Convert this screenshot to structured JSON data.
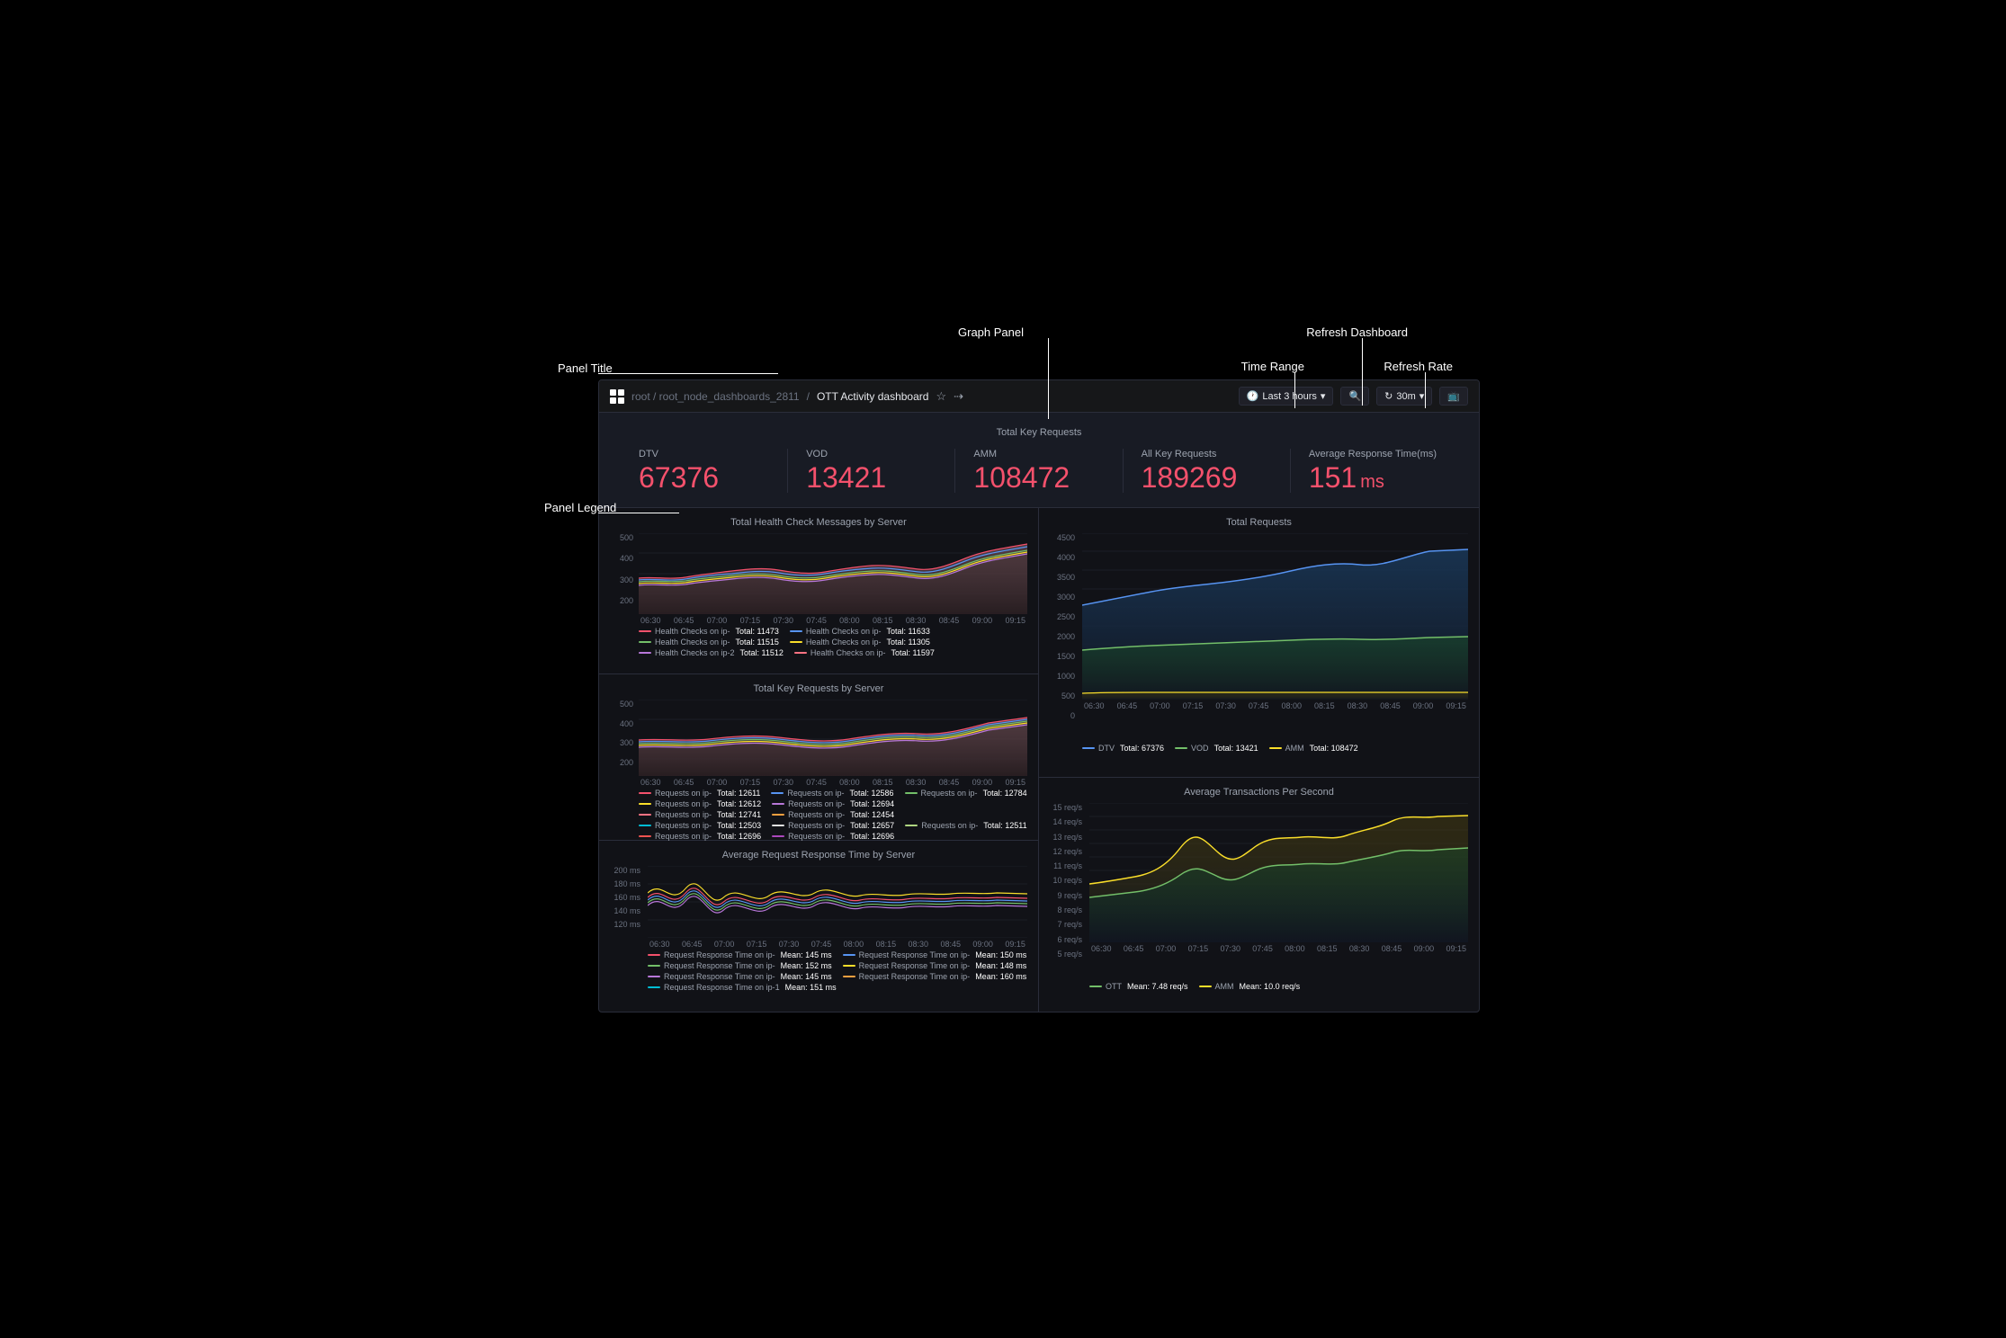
{
  "annotations": {
    "graph_panel": "Graph Panel",
    "panel_title": "Panel Title",
    "panel_legend": "Panel Legend",
    "refresh_dashboard": "Refresh Dashboard",
    "time_range": "Time Range",
    "refresh_rate": "Refresh Rate"
  },
  "topbar": {
    "breadcrumb": "root / root_node_dashboards_2811",
    "separator": "/",
    "title": "OTT Activity dashboard",
    "time_range": "Last 3 hours",
    "zoom_icon": "🔍",
    "refresh_icon": "↻",
    "refresh_rate": "30m",
    "tv_icon": "📺"
  },
  "stats": {
    "title": "Total Key Requests",
    "items": [
      {
        "label": "DTV",
        "value": "67376",
        "unit": ""
      },
      {
        "label": "VOD",
        "value": "13421",
        "unit": ""
      },
      {
        "label": "AMM",
        "value": "108472",
        "unit": ""
      },
      {
        "label": "All Key Requests",
        "value": "189269",
        "unit": ""
      },
      {
        "label": "Average Response Time(ms)",
        "value": "151",
        "unit": " ms"
      }
    ]
  },
  "panels": {
    "left": [
      {
        "title": "Total Health Check Messages by Server",
        "y_labels": [
          "500",
          "400",
          "300",
          "200"
        ],
        "x_labels": [
          "06:30",
          "06:45",
          "07:00",
          "07:15",
          "07:30",
          "07:45",
          "08:00",
          "08:15",
          "08:30",
          "08:45",
          "09:00",
          "09:15"
        ],
        "legend": [
          {
            "color": "#f4516c",
            "label": "Health Checks on ip-",
            "total": "Total: 11473"
          },
          {
            "color": "#5794f2",
            "label": "Health Checks on ip-",
            "total": "Total: 11633"
          },
          {
            "color": "#73bf69",
            "label": "Health Checks on ip-",
            "total": "Total: 11515"
          },
          {
            "color": "#fade2a",
            "label": "Health Checks on ip-",
            "total": "Total: 11305"
          },
          {
            "color": "#b877d9",
            "label": "Health Checks on ip-2",
            "total": "Total: 11512"
          },
          {
            "color": "#ff7383",
            "label": "Health Checks on ip-",
            "total": "Total: 11597"
          }
        ]
      },
      {
        "title": "Total Key Requests by Server",
        "y_labels": [
          "500",
          "400",
          "300",
          "200"
        ],
        "x_labels": [
          "06:30",
          "06:45",
          "07:00",
          "07:15",
          "07:30",
          "07:45",
          "08:00",
          "08:15",
          "08:30",
          "08:45",
          "09:00",
          "09:15"
        ],
        "legend": [
          {
            "color": "#f4516c",
            "label": "Requests on ip-",
            "total": "Total: 12611"
          },
          {
            "color": "#5794f2",
            "label": "Requests on ip-",
            "total": "Total: 12586"
          },
          {
            "color": "#73bf69",
            "label": "Requests on ip-",
            "total": "Total: 12784"
          },
          {
            "color": "#fade2a",
            "label": "Requests on ip-",
            "total": "Total: 12612"
          },
          {
            "color": "#b877d9",
            "label": "Requests on ip-",
            "total": "Total: 12694"
          },
          {
            "color": "#ff7383",
            "label": "Requests on ip-",
            "total": "Total: 12741"
          },
          {
            "color": "#f9a040",
            "label": "Requests on ip-",
            "total": "Total: 12454"
          },
          {
            "color": "#00bcd4",
            "label": "Requests on ip-",
            "total": "Total: 12503"
          },
          {
            "color": "#e0e0e0",
            "label": "Requests on ip-",
            "total": "Total: 12657"
          },
          {
            "color": "#aed581",
            "label": "Requests on ip-",
            "total": "Total: 12511"
          },
          {
            "color": "#ef5350",
            "label": "Requests on ip-",
            "total": "Total: 12696"
          },
          {
            "color": "#ab47bc",
            "label": "Requests on ip-",
            "total": "Total: 12696"
          }
        ]
      },
      {
        "title": "Average Request Response Time by Server",
        "y_labels": [
          "200 ms",
          "180 ms",
          "160 ms",
          "140 ms",
          "120 ms"
        ],
        "x_labels": [
          "06:30",
          "06:45",
          "07:00",
          "07:15",
          "07:30",
          "07:45",
          "08:00",
          "08:15",
          "08:30",
          "08:45",
          "09:00",
          "09:15"
        ],
        "legend": [
          {
            "color": "#f4516c",
            "label": "Request Response Time on ip-",
            "total": "Mean: 145 ms"
          },
          {
            "color": "#5794f2",
            "label": "Request Response Time on ip-",
            "total": "Mean: 150 ms"
          },
          {
            "color": "#73bf69",
            "label": "Request Response Time on ip-",
            "total": "Mean: 152 ms"
          },
          {
            "color": "#fade2a",
            "label": "Request Response Time on ip-",
            "total": "Mean: 148 ms"
          },
          {
            "color": "#b877d9",
            "label": "Request Response Time on ip-",
            "total": "Mean: 145 ms"
          },
          {
            "color": "#f9a040",
            "label": "Request Response Time on ip-",
            "total": "Mean: 160 ms"
          },
          {
            "color": "#00bcd4",
            "label": "Request Response Time on ip-1",
            "total": "Mean: 151 ms"
          }
        ]
      }
    ],
    "right": [
      {
        "title": "Total Requests",
        "y_labels": [
          "4500",
          "4000",
          "3500",
          "3000",
          "2500",
          "2000",
          "1500",
          "1000",
          "500",
          "0"
        ],
        "x_labels": [
          "06:30",
          "06:45",
          "07:00",
          "07:15",
          "07:30",
          "07:45",
          "08:00",
          "08:15",
          "08:30",
          "08:45",
          "09:00",
          "09:15"
        ],
        "legend": [
          {
            "color": "#5794f2",
            "label": "DTV",
            "total": "Total: 67376"
          },
          {
            "color": "#73bf69",
            "label": "VOD",
            "total": "Total: 13421"
          },
          {
            "color": "#fade2a",
            "label": "AMM",
            "total": "Total: 108472"
          }
        ]
      },
      {
        "title": "Average Transactions Per Second",
        "y_labels": [
          "15 req/s",
          "14 req/s",
          "13 req/s",
          "12 req/s",
          "11 req/s",
          "10 req/s",
          "9 req/s",
          "8 req/s",
          "7 req/s",
          "6 req/s",
          "5 req/s"
        ],
        "x_labels": [
          "06:30",
          "06:45",
          "07:00",
          "07:15",
          "07:30",
          "07:45",
          "08:00",
          "08:15",
          "08:30",
          "08:45",
          "09:00",
          "09:15"
        ],
        "legend": [
          {
            "color": "#73bf69",
            "label": "OTT",
            "total": "Mean: 7.48 req/s"
          },
          {
            "color": "#fade2a",
            "label": "AMM",
            "total": "Mean: 10.0 req/s"
          }
        ]
      }
    ]
  }
}
